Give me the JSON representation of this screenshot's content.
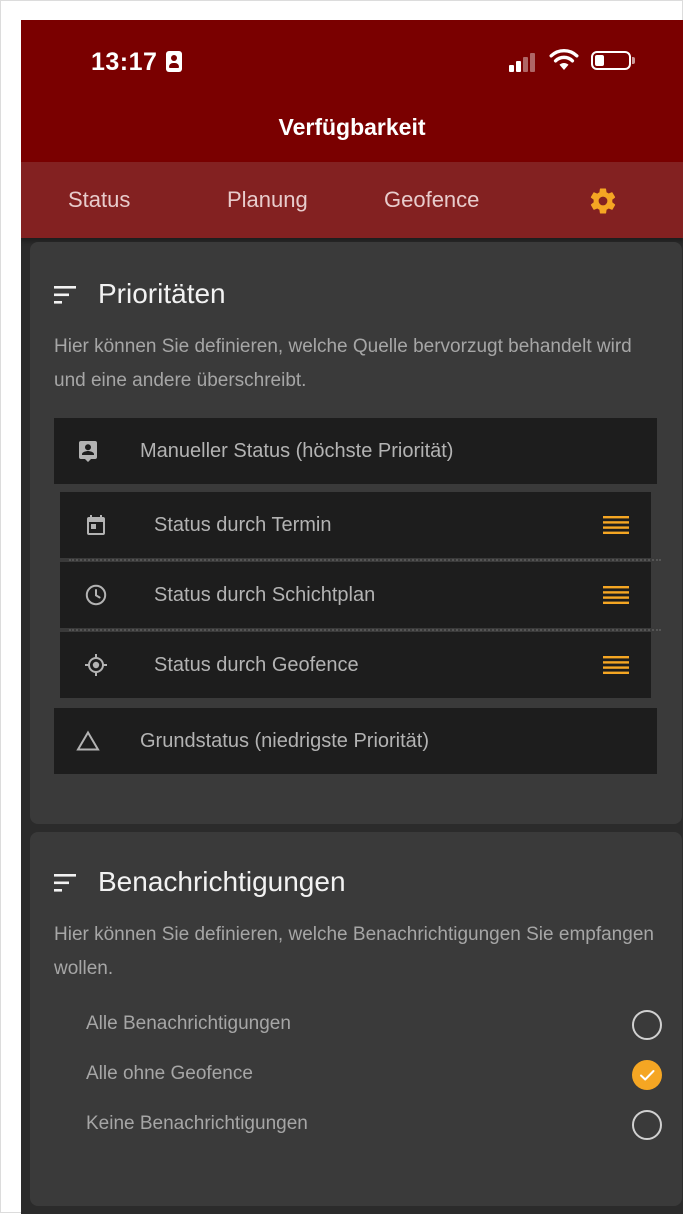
{
  "status_bar": {
    "time": "13:17"
  },
  "header": {
    "title": "Verfügbarkeit"
  },
  "tabs": [
    {
      "label": "Status"
    },
    {
      "label": "Planung"
    },
    {
      "label": "Geofence"
    }
  ],
  "icons": {
    "settings": "gear-icon",
    "sort": "sort-icon",
    "manual": "contact-card-icon",
    "appointment": "calendar-icon",
    "shift": "clock-icon",
    "geofence": "location-target-icon",
    "base": "triangle-icon",
    "drag": "drag-handle-icon",
    "check": "check-icon"
  },
  "colors": {
    "header_bg": "#7a0000",
    "tabs_bg": "#832121",
    "accent": "#f5a623",
    "card_bg": "#3a3a3a",
    "row_bg": "#1d1d1d"
  },
  "priorities": {
    "title": "Prioritäten",
    "description": "Hier können Sie definieren, welche Quelle bervorzugt behandelt wird und eine andere überschreibt.",
    "top": {
      "label": "Manueller Status (höchste Priorität)"
    },
    "items": [
      {
        "label": "Status durch Termin"
      },
      {
        "label": "Status durch Schichtplan"
      },
      {
        "label": "Status durch Geofence"
      }
    ],
    "bottom": {
      "label": "Grundstatus (niedrigste Priorität)"
    }
  },
  "notifications": {
    "title": "Benachrichtigungen",
    "description": "Hier können Sie definieren, welche Benachrichtigungen Sie empfangen wollen.",
    "options": [
      {
        "label": "Alle Benachrichtigungen",
        "selected": false
      },
      {
        "label": "Alle ohne Geofence",
        "selected": true
      },
      {
        "label": "Keine Benachrichtigungen",
        "selected": false
      }
    ]
  }
}
